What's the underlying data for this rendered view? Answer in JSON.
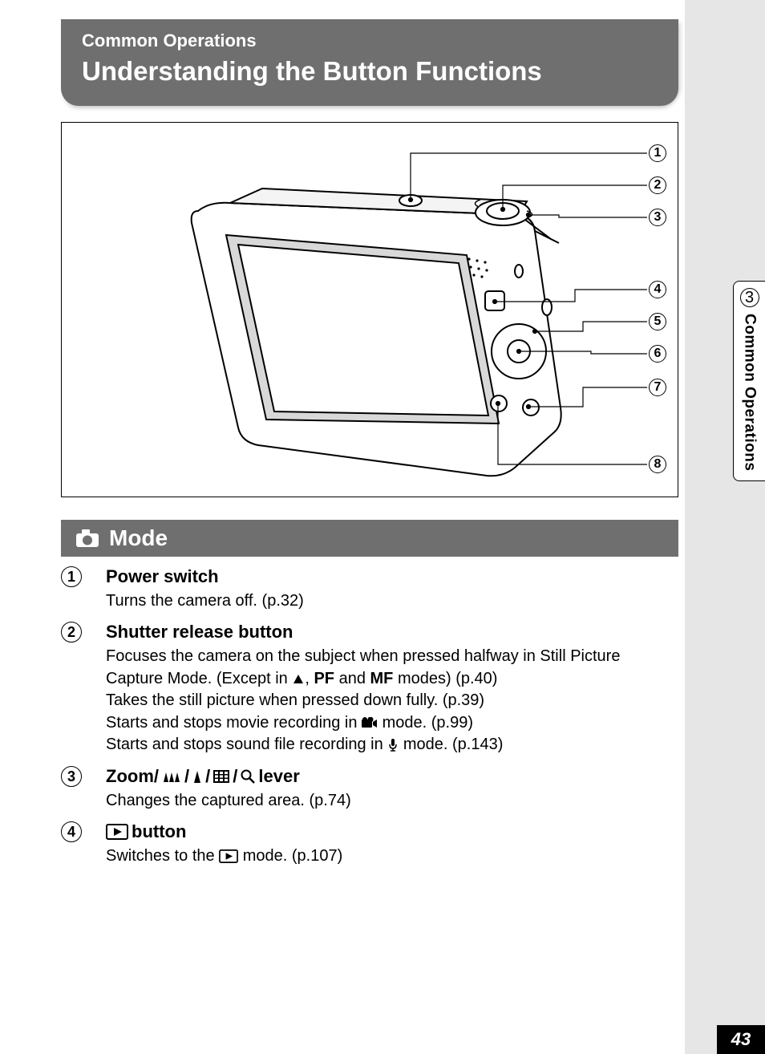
{
  "header": {
    "subtitle": "Common Operations",
    "title": "Understanding the Button Functions"
  },
  "side": {
    "chapter": "3",
    "label": "Common Operations"
  },
  "page_number": "43",
  "callouts": [
    "1",
    "2",
    "3",
    "4",
    "5",
    "6",
    "7",
    "8"
  ],
  "mode_section": {
    "label": "Mode"
  },
  "items": [
    {
      "num": "1",
      "title": "Power switch",
      "desc_pre": "Turns the camera off. ",
      "ref1": "(p.32)"
    },
    {
      "num": "2",
      "title": "Shutter release button",
      "line1_a": "Focuses the camera on the subject when pressed halfway in Still Picture Capture Mode. (Except in ",
      "pf": "PF",
      "and": " and ",
      "mf": "MF",
      "line1_b": " modes) ",
      "ref_a": "(p.40)",
      "line2": "Takes the still picture when pressed down fully. ",
      "ref_b": "(p.39)",
      "line3_a": "Starts and stops movie recording in ",
      "line3_b": " mode. ",
      "ref_c": "(p.99)",
      "line4_a": "Starts and stops sound file recording in ",
      "line4_b": " mode. ",
      "ref_d": "(p.143)"
    },
    {
      "num": "3",
      "title_a": "Zoom/",
      "title_b": "/",
      "title_c": " /",
      "title_d": "/",
      "title_e": " lever",
      "desc": "Changes the captured area. ",
      "ref": "(p.74)"
    },
    {
      "num": "4",
      "title_suffix": " button",
      "desc_a": "Switches to the ",
      "desc_b": " mode. ",
      "ref": "(p.107)"
    }
  ],
  "comma": ", "
}
